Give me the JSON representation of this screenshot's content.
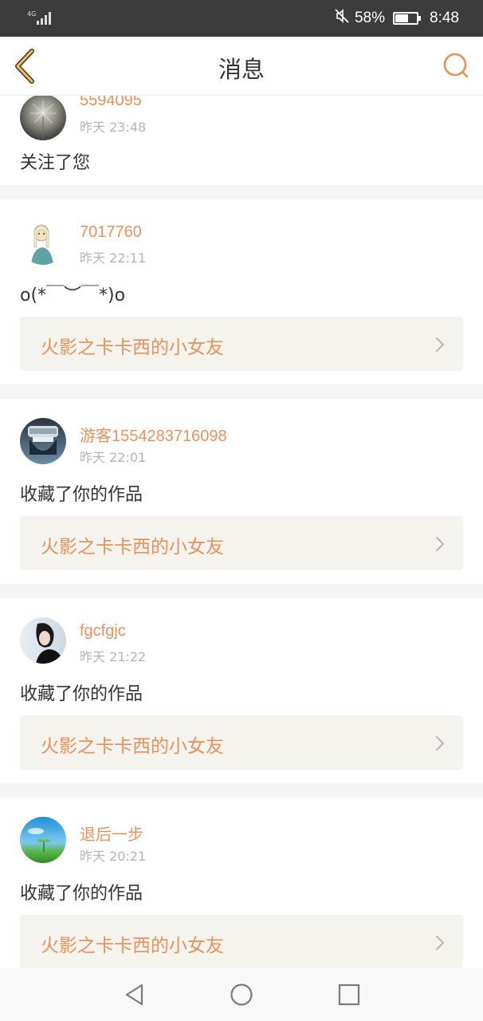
{
  "status_bar": {
    "network_text": "4G",
    "battery_percent": "58%",
    "time": "8:48"
  },
  "nav": {
    "title": "消息"
  },
  "colors": {
    "accent": "#e8925a",
    "work_bg": "#f4f3ee",
    "status_bg": "#3c3c3c"
  },
  "notifications": [
    {
      "username": "5594095",
      "time": "昨天 23:48",
      "message": "关注了您",
      "work_title": ""
    },
    {
      "username": "7017760",
      "time": "昨天 22:11",
      "message": "o(*￣︶￣*)o",
      "work_title": "火影之卡卡西的小女友"
    },
    {
      "username": "游客1554283716098",
      "time": "昨天 22:01",
      "message": "收藏了你的作品",
      "work_title": "火影之卡卡西的小女友"
    },
    {
      "username": "fgcfgjc",
      "time": "昨天 21:22",
      "message": "收藏了你的作品",
      "work_title": "火影之卡卡西的小女友"
    },
    {
      "username": "退后一步",
      "time": "昨天 20:21",
      "message": "收藏了你的作品",
      "work_title": "火影之卡卡西的小女友"
    }
  ],
  "icons": {
    "back": "chevron-left-icon",
    "search": "search-icon",
    "work_arrow": "chevron-right-icon",
    "sys_back": "triangle-back-icon",
    "sys_home": "circle-home-icon",
    "sys_recent": "square-recent-icon"
  }
}
